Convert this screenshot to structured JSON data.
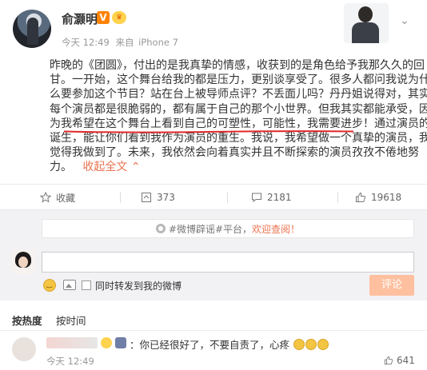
{
  "post": {
    "author_name": "俞灏明",
    "verified_badge": "V",
    "rank_badge": "👑",
    "time": "今天 12:49",
    "source_prefix": "来自",
    "source": "iPhone 7",
    "content_lines": [
      "昨晚的《团圆》，付出的是我真挚的情感，收获到的是角色给予我那久久的回",
      "甘。一开始，这个舞台给我的都是压力，更别谈享受了。很多人都问我说为什",
      "么要参加这个节目？站在台上被导师点评？不丢面儿吗？丹丹姐说得对，其实",
      "每个演员都是很脆弱的，都有属于自己的那个小世界。但我其实都能承受，因",
      "为我希望在这个舞台上看到自己的可塑性，可能性，我需要进步！通过演员的",
      "诞生，能让你们看到我作为演员的重生。我说，我希望做一个真挚的演员，我",
      "觉得我做到了。未来，我依然会向着真实并且不断探索的演员孜孜不倦地努"
    ],
    "last_line": "力。",
    "expand_label": "收起全文",
    "expand_icon": "chevron-up-icon",
    "underline_color": "#e0272a"
  },
  "actions": {
    "favorite_label": "收藏",
    "repost_count": "373",
    "comment_count": "2181",
    "like_count": "19618"
  },
  "comment_box": {
    "tag_text": "#微博辟谣#平台，",
    "tag_highlight": "欢迎查阅！",
    "input_placeholder": "",
    "repost_checkbox_label": "同时转发到我的微博",
    "submit_label": "评论"
  },
  "sort": {
    "hot_label": "按热度",
    "time_label": "按时间"
  },
  "comments": [
    {
      "text": "：你已经很好了，不要自责了，心疼",
      "emoji_count": 3,
      "time": "今天 12:49",
      "likes": "641"
    }
  ],
  "colors": {
    "accent": "#eb7350",
    "verified": "#ff8200",
    "submit_disabled": "#ffc09f",
    "comment_bg": "#f2f2f5"
  }
}
